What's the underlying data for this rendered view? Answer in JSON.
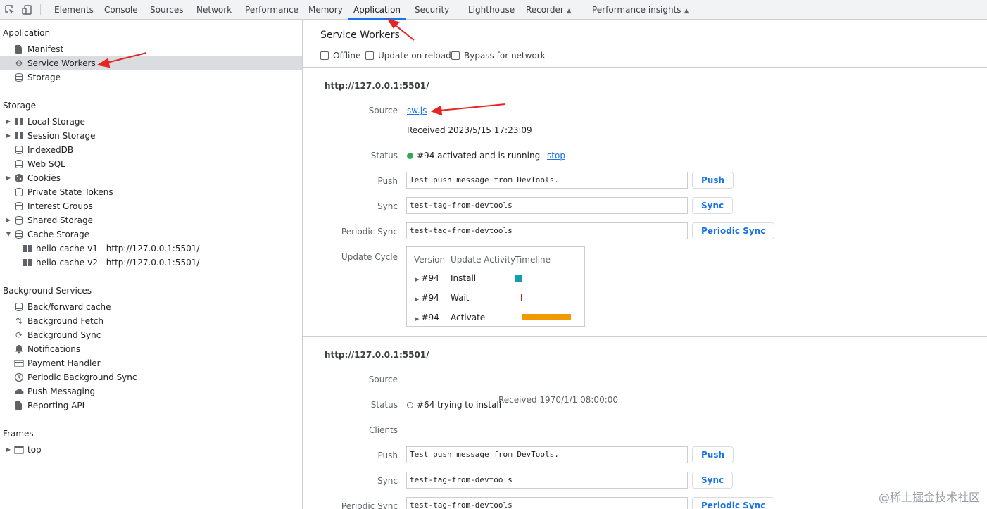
{
  "tabs": [
    "Elements",
    "Console",
    "Sources",
    "Network",
    "Performance",
    "Memory",
    "Application",
    "Security",
    "Lighthouse",
    "Recorder",
    "Performance insights"
  ],
  "active_tab": "Application",
  "sidebar": {
    "application_title": "Application",
    "application_items": [
      "Manifest",
      "Service Workers",
      "Storage"
    ],
    "selected_item": "Service Workers",
    "storage_title": "Storage",
    "storage_items": [
      "Local Storage",
      "Session Storage",
      "IndexedDB",
      "Web SQL",
      "Cookies",
      "Private State Tokens",
      "Interest Groups",
      "Shared Storage",
      "Cache Storage"
    ],
    "cache_items": [
      "hello-cache-v1 - http://127.0.0.1:5501/",
      "hello-cache-v2 - http://127.0.0.1:5501/"
    ],
    "bg_title": "Background Services",
    "bg_items": [
      "Back/forward cache",
      "Background Fetch",
      "Background Sync",
      "Notifications",
      "Payment Handler",
      "Periodic Background Sync",
      "Push Messaging",
      "Reporting API"
    ],
    "frames_title": "Frames",
    "frames_items": [
      "top"
    ]
  },
  "main": {
    "title": "Service Workers",
    "options": [
      "Offline",
      "Update on reload",
      "Bypass for network"
    ],
    "labels": {
      "source": "Source",
      "status": "Status",
      "push": "Push",
      "sync": "Sync",
      "periodic_sync": "Periodic Sync",
      "update_cycle": "Update Cycle",
      "clients": "Clients"
    },
    "buttons": {
      "push": "Push",
      "sync": "Sync",
      "periodic_sync": "Periodic Sync"
    },
    "worker1": {
      "url": "http://127.0.0.1:5501/",
      "source_link": "sw.js",
      "received": "Received 2023/5/15 17:23:09",
      "status": "#94 activated and is running",
      "status_color": "#34a853",
      "stop_link": "stop",
      "push_value": "Test push message from DevTools.",
      "sync_value": "test-tag-from-devtools",
      "periodic_value": "test-tag-from-devtools",
      "cycle_headers": [
        "Version",
        "Update Activity",
        "Timeline"
      ],
      "cycle_rows": [
        {
          "version": "#94",
          "activity": "Install",
          "timeline_color": "#129eaf"
        },
        {
          "version": "#94",
          "activity": "Wait",
          "timeline_color": "#c5221f"
        },
        {
          "version": "#94",
          "activity": "Activate",
          "timeline_color": "#f29900"
        }
      ]
    },
    "worker2": {
      "url": "http://127.0.0.1:5501/",
      "status": "#64 trying to install",
      "received": "Received 1970/1/1 08:00:00",
      "push_value": "Test push message from DevTools.",
      "sync_value": "test-tag-from-devtools",
      "periodic_value": "test-tag-from-devtools"
    }
  },
  "watermark": "@稀土掘金技术社区"
}
